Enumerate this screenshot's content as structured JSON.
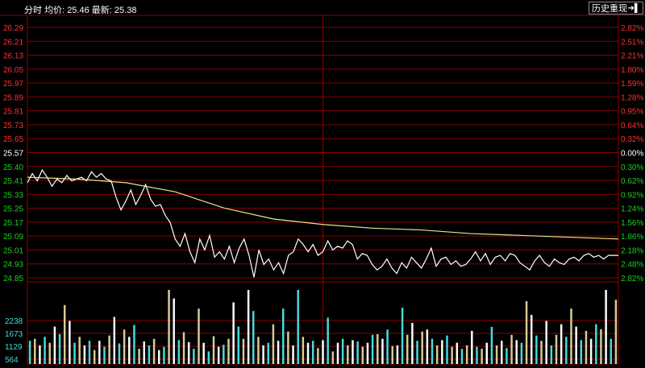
{
  "header": {
    "mode_label": "分时",
    "avg_label": "均价:",
    "avg_value": "25.46",
    "last_label": "最新:",
    "last_value": "25.38",
    "history_button": "历史重现",
    "history_icon": "exit-arrow-icon"
  },
  "colors": {
    "background": "#000000",
    "grid": "#8b0000",
    "price_line": "#ffffff",
    "avg_line": "#e6e68c",
    "up": "#ff3030",
    "down": "#22cc22",
    "neutral": "#ffffff",
    "volume_cyan": "#44dddd",
    "volume_tan": "#d8cc96"
  },
  "chart_data": {
    "type": "line",
    "title": "",
    "prev_close": 25.57,
    "price_ticks": [
      "26.29",
      "26.21",
      "26.13",
      "26.05",
      "25.97",
      "25.89",
      "25.81",
      "25.73",
      "25.65",
      "25.57",
      "25.40",
      "25.41",
      "25.33",
      "25.25",
      "25.17",
      "25.09",
      "25.01",
      "24.93",
      "24.85"
    ],
    "percent_ticks": [
      "2.82%",
      "2.51%",
      "2.21%",
      "1.80%",
      "1.59%",
      "1.28%",
      "0.95%",
      "0.64%",
      "0.32%",
      "0.00%",
      "0.30%",
      "0.62%",
      "0.92%",
      "1.24%",
      "1.56%",
      "1.86%",
      "2.18%",
      "2.48%",
      "2.82%"
    ],
    "volume_ticks": [
      "2238",
      "1673",
      "1129",
      "564"
    ],
    "ylim": [
      24.85,
      26.29
    ],
    "grid": true,
    "series": [
      {
        "name": "",
        "x": [
          0,
          1,
          2,
          3,
          4,
          5,
          6,
          7,
          8,
          9,
          10,
          11,
          12,
          13,
          14,
          15,
          16,
          17,
          18,
          19,
          20,
          21,
          22,
          23,
          24,
          25,
          26,
          27,
          28,
          29,
          30,
          31,
          32,
          33,
          34,
          35,
          36,
          37,
          38,
          39,
          40,
          41,
          42,
          43,
          44,
          45,
          46,
          47,
          48,
          49,
          50,
          51,
          52,
          53,
          54,
          55,
          56,
          57,
          58,
          59,
          60,
          61,
          62,
          63,
          64,
          65,
          66,
          67,
          68,
          69,
          70,
          71,
          72,
          73,
          74,
          75,
          76,
          77,
          78,
          79,
          80,
          81,
          82,
          83,
          84,
          85,
          86,
          87,
          88,
          89,
          90,
          91,
          92,
          93,
          94,
          95,
          96,
          97,
          98,
          99,
          100,
          101,
          102,
          103,
          104,
          105,
          106,
          107,
          108,
          109,
          110,
          111,
          112,
          113,
          114,
          115,
          116,
          117,
          118,
          119,
          120
        ],
        "values": [
          25.4,
          25.45,
          25.41,
          25.47,
          25.43,
          25.38,
          25.42,
          25.4,
          25.44,
          25.41,
          25.42,
          25.43,
          25.41,
          25.46,
          25.43,
          25.45,
          25.42,
          25.41,
          25.32,
          25.25,
          25.3,
          25.36,
          25.28,
          25.33,
          25.39,
          25.31,
          25.27,
          25.28,
          25.22,
          25.18,
          25.09,
          25.05,
          25.12,
          25.02,
          24.96,
          25.09,
          25.03,
          25.11,
          24.99,
          25.02,
          24.98,
          25.05,
          24.96,
          25.04,
          25.09,
          25.0,
          24.88,
          25.03,
          24.95,
          24.98,
          24.92,
          24.96,
          24.9,
          25.0,
          25.02,
          25.09,
          25.06,
          25.02,
          25.06,
          25.0,
          25.02,
          25.08,
          25.03,
          25.05,
          25.04,
          25.08,
          25.06,
          24.98,
          25.01,
          25.0,
          24.95,
          24.92,
          24.94,
          24.98,
          24.93,
          24.9,
          24.96,
          24.93,
          24.99,
          24.96,
          24.93,
          24.98,
          25.04,
          24.94,
          24.98,
          24.99,
          24.95,
          24.97,
          24.94,
          24.95,
          24.98,
          25.02,
          24.97,
          25.01,
          24.95,
          24.99,
          25.0,
          24.97,
          25.01,
          25.0,
          24.96,
          24.94,
          24.92,
          24.97,
          25.0,
          24.96,
          24.94,
          24.98,
          24.96,
          24.95,
          24.98,
          24.99,
          24.97,
          25.0,
          25.01,
          24.99,
          25.0,
          24.98,
          25.0,
          25.0,
          25.0
        ]
      },
      {
        "name": "",
        "x": [
          0,
          10,
          20,
          30,
          40,
          50,
          60,
          70,
          80,
          90,
          100,
          110,
          120
        ],
        "values": [
          25.43,
          25.42,
          25.4,
          25.35,
          25.26,
          25.2,
          25.17,
          25.15,
          25.14,
          25.12,
          25.11,
          25.1,
          25.09
        ]
      }
    ],
    "volume": [
      700,
      760,
      560,
      820,
      640,
      1129,
      900,
      1780,
      1300,
      640,
      820,
      560,
      700,
      420,
      700,
      520,
      860,
      1420,
      620,
      1040,
      820,
      1180,
      460,
      680,
      560,
      760,
      420,
      520,
      2238,
      1980,
      720,
      960,
      660,
      460,
      1673,
      640,
      380,
      840,
      520,
      580,
      760,
      1860,
      1129,
      760,
      2238,
      1600,
      820,
      560,
      640,
      1200,
      700,
      1673,
      980,
      560,
      2238,
      820,
      640,
      700,
      480,
      720,
      1400,
      380,
      640,
      760,
      560,
      720,
      680,
      520,
      640,
      880,
      900,
      760,
      1040,
      540,
      560,
      1700,
      880,
      1240,
      700,
      980,
      1040,
      760,
      560,
      720,
      860,
      520,
      640,
      460,
      560,
      1000,
      520,
      460,
      640,
      1120,
      560,
      700,
      480,
      880,
      720,
      640,
      1900,
      1480,
      860,
      700,
      1300,
      560,
      880,
      1200,
      820,
      1673,
      1129,
      720,
      1000,
      760,
      1200,
      1050,
      2238,
      760,
      1940
    ]
  }
}
